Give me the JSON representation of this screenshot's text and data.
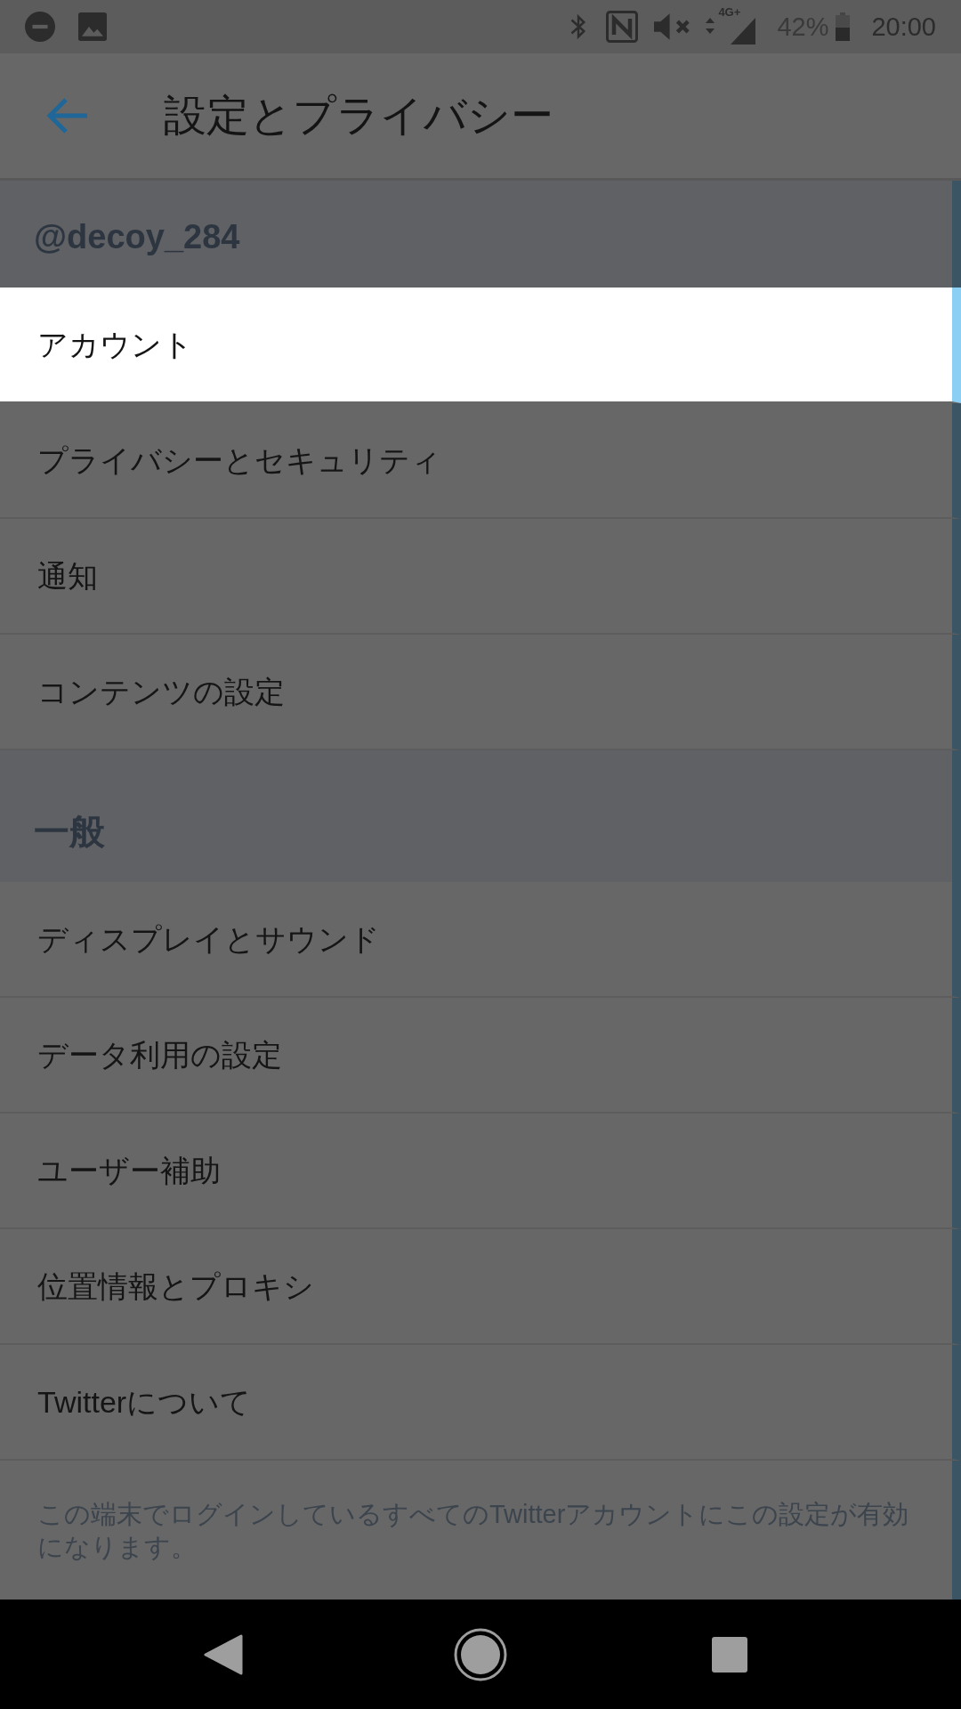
{
  "status_bar": {
    "network_type": "4G+",
    "battery": "42%",
    "time": "20:00"
  },
  "app_bar": {
    "title": "設定とプライバシー"
  },
  "sections": [
    {
      "header": "@decoy_284",
      "items": [
        {
          "label": "アカウント",
          "highlighted": true
        },
        {
          "label": "プライバシーとセキュリティ",
          "highlighted": false
        },
        {
          "label": "通知",
          "highlighted": false
        },
        {
          "label": "コンテンツの設定",
          "highlighted": false
        }
      ]
    },
    {
      "header": "一般",
      "items": [
        {
          "label": "ディスプレイとサウンド",
          "highlighted": false
        },
        {
          "label": "データ利用の設定",
          "highlighted": false
        },
        {
          "label": "ユーザー補助",
          "highlighted": false
        },
        {
          "label": "位置情報とプロキシ",
          "highlighted": false
        },
        {
          "label": "Twitterについて",
          "highlighted": false
        }
      ]
    }
  ],
  "footer_note": "この端末でログインしているすべてのTwitterアカウントにこの設定が有効になります。"
}
